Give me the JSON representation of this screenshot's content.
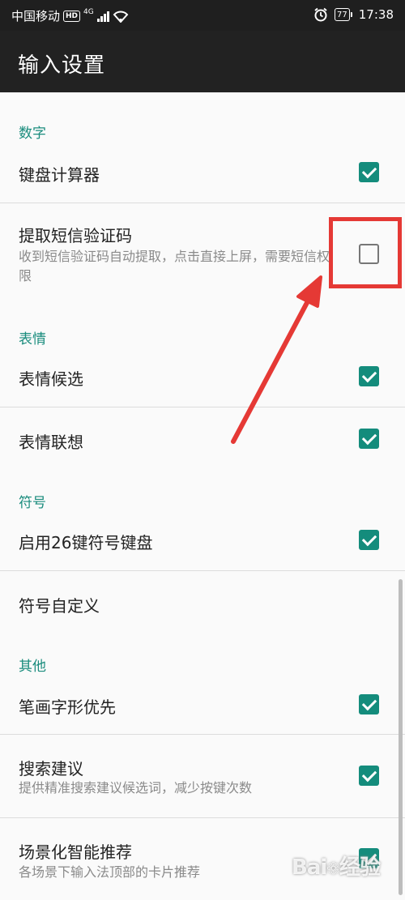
{
  "statusbar": {
    "carrier": "中国移动",
    "hd": "HD",
    "network": "4G",
    "battery": "77",
    "time": "17:38"
  },
  "appbar": {
    "title": "输入设置"
  },
  "sections": {
    "digits": "数字",
    "emoji": "表情",
    "symbols": "符号",
    "other": "其他"
  },
  "items": {
    "keyboard_calculator": {
      "label": "键盘计算器",
      "checked": true
    },
    "sms_code": {
      "label": "提取短信验证码",
      "desc": "收到短信验证码自动提取，点击直接上屏，需要短信权限",
      "checked": false
    },
    "emoji_candidates": {
      "label": "表情候选",
      "checked": true
    },
    "emoji_association": {
      "label": "表情联想",
      "checked": true
    },
    "symbol_26key": {
      "label": "启用26键符号键盘",
      "checked": true
    },
    "custom_symbols": {
      "label": "符号自定义"
    },
    "stroke_glyph": {
      "label": "笔画字形优先",
      "checked": true
    },
    "search_suggest": {
      "label": "搜索建议",
      "desc": "提供精准搜索建议候选词，减少按键次数",
      "checked": true
    },
    "scene_recommend": {
      "label": "场景化智能推荐",
      "desc": "各场景下输入法顶部的卡片推荐",
      "checked": true
    }
  },
  "colors": {
    "accent": "#148c7c",
    "annotation": "#e53935"
  },
  "watermark": "Bai 经验"
}
